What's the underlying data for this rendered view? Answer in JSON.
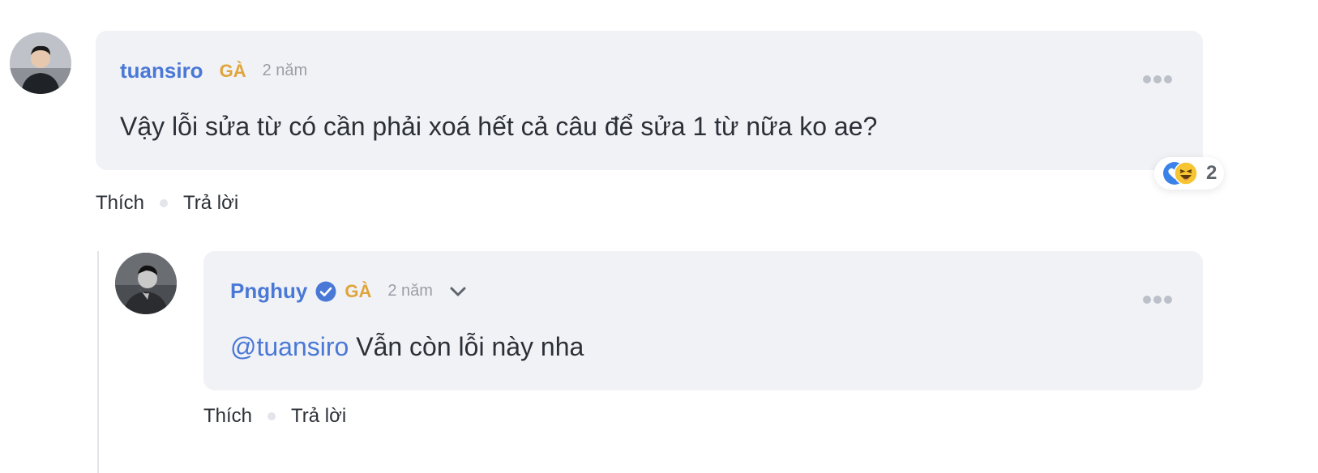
{
  "comments": [
    {
      "author": "tuansiro",
      "rank": "GÀ",
      "time": "2 năm",
      "text": "Vậy lỗi sửa từ có cần phải xoá hết cả câu để sửa 1 từ nữa ko ae?",
      "reactions": {
        "icons": [
          "love-icon",
          "haha-icon"
        ],
        "count": "2"
      },
      "actions": {
        "like": "Thích",
        "reply": "Trả lời"
      }
    },
    {
      "author": "Pnghuy",
      "verified": true,
      "rank": "GÀ",
      "time": "2 năm",
      "mention": "@tuansiro",
      "text": "Vẫn còn lỗi này nha",
      "actions": {
        "like": "Thích",
        "reply": "Trả lời"
      }
    }
  ],
  "colors": {
    "author": "#4a78d6",
    "rank": "#e0a43a",
    "bubble": "#f1f2f6"
  }
}
